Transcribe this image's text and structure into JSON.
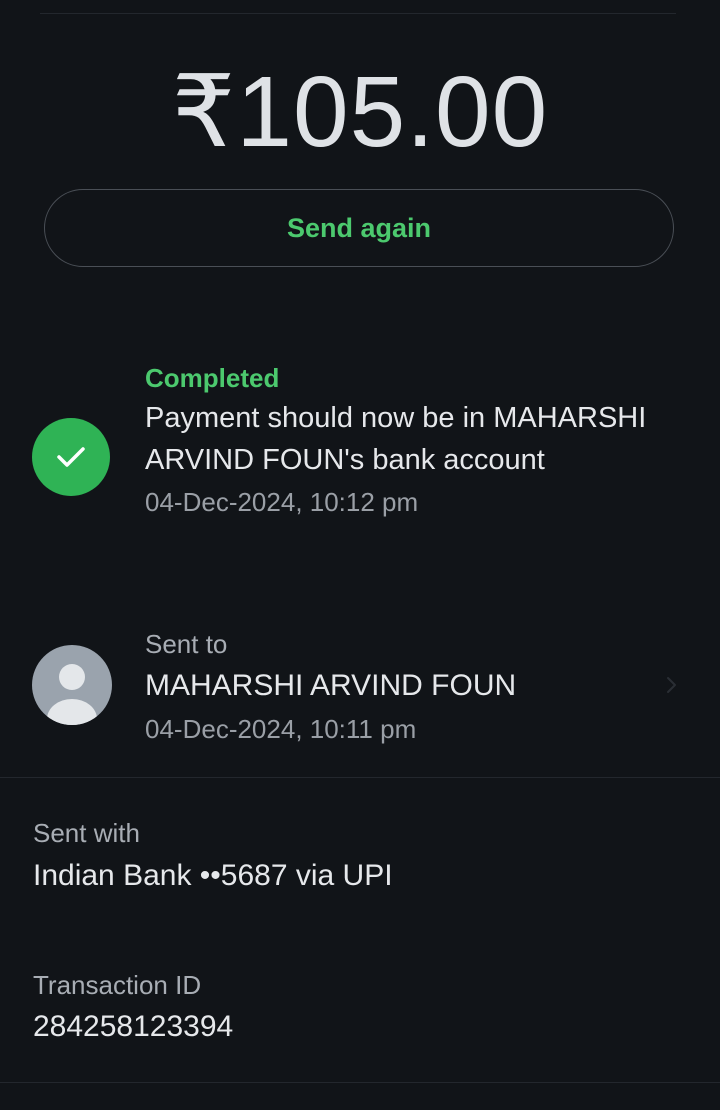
{
  "payment": {
    "amount": "₹105.00",
    "send_again_label": "Send again"
  },
  "status": {
    "label": "Completed",
    "message": "Payment should now be in MAHARSHI ARVIND FOUN's bank account",
    "timestamp": "04-Dec-2024, 10:12 pm",
    "icon": "check-icon",
    "color": "#2fb355"
  },
  "recipient": {
    "label": "Sent to",
    "name": "MAHARSHI ARVIND FOUN",
    "timestamp": "04-Dec-2024, 10:11 pm",
    "icon": "avatar-icon"
  },
  "details": {
    "sent_with_label": "Sent with",
    "sent_with_value": "Indian Bank ••5687 via UPI",
    "transaction_id_label": "Transaction ID",
    "transaction_id_value": "284258123394"
  },
  "colors": {
    "background": "#111418",
    "accent_green": "#4cc96e",
    "text_primary": "#e6e8eb",
    "text_secondary": "#9a9fa6"
  }
}
